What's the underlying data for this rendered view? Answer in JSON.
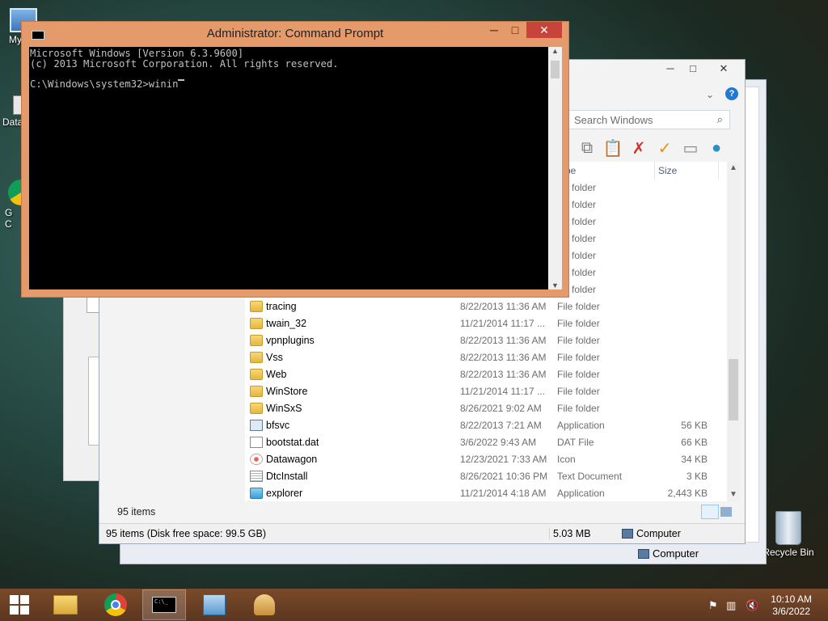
{
  "desktop": {
    "icons": [
      {
        "label": "My C"
      },
      {
        "label": "Data"
      },
      {
        "label": "G C"
      },
      {
        "label": "Recycle Bin"
      }
    ]
  },
  "explorer_back": {
    "status_location": "Computer"
  },
  "explorer": {
    "search_placeholder": "Search Windows",
    "columns": {
      "type": "pe",
      "size": "Size"
    },
    "partial_rows": [
      {
        "type": "e folder"
      },
      {
        "type": "e folder"
      },
      {
        "type": "e folder"
      },
      {
        "type": "e folder"
      },
      {
        "type": "e folder"
      },
      {
        "type": "e folder"
      },
      {
        "type": "e folder"
      }
    ],
    "rows": [
      {
        "icon": "folder",
        "name": "tracing",
        "date": "8/22/2013 11:36 AM",
        "type": "File folder",
        "size": ""
      },
      {
        "icon": "folder",
        "name": "twain_32",
        "date": "11/21/2014 11:17 ...",
        "type": "File folder",
        "size": ""
      },
      {
        "icon": "folder",
        "name": "vpnplugins",
        "date": "8/22/2013 11:36 AM",
        "type": "File folder",
        "size": ""
      },
      {
        "icon": "folder",
        "name": "Vss",
        "date": "8/22/2013 11:36 AM",
        "type": "File folder",
        "size": ""
      },
      {
        "icon": "folder",
        "name": "Web",
        "date": "8/22/2013 11:36 AM",
        "type": "File folder",
        "size": ""
      },
      {
        "icon": "folder",
        "name": "WinStore",
        "date": "11/21/2014 11:17 ...",
        "type": "File folder",
        "size": ""
      },
      {
        "icon": "folder",
        "name": "WinSxS",
        "date": "8/26/2021 9:02 AM",
        "type": "File folder",
        "size": ""
      },
      {
        "icon": "app",
        "name": "bfsvc",
        "date": "8/22/2013 7:21 AM",
        "type": "Application",
        "size": "56 KB"
      },
      {
        "icon": "file",
        "name": "bootstat.dat",
        "date": "3/6/2022 9:43 AM",
        "type": "DAT File",
        "size": "66 KB"
      },
      {
        "icon": "icon",
        "name": "Datawagon",
        "date": "12/23/2021 7:33 AM",
        "type": "Icon",
        "size": "34 KB"
      },
      {
        "icon": "txt",
        "name": "DtcInstall",
        "date": "8/26/2021 10:36 PM",
        "type": "Text Document",
        "size": "3 KB"
      },
      {
        "icon": "app",
        "name": "explorer",
        "date": "11/21/2014 4:18 AM",
        "type": "Application",
        "size": "2,443 KB"
      }
    ],
    "items_count": "95 items",
    "status": {
      "summary": "95 items (Disk free space: 99.5 GB)",
      "size": "5.03 MB",
      "location": "Computer"
    }
  },
  "cmd": {
    "title": "Administrator: Command Prompt",
    "lines": [
      "Microsoft Windows [Version 6.3.9600]",
      "(c) 2013 Microsoft Corporation. All rights reserved.",
      "",
      "C:\\Windows\\system32>winin"
    ]
  },
  "taskbar": {
    "time": "10:10 AM",
    "date": "3/6/2022"
  }
}
